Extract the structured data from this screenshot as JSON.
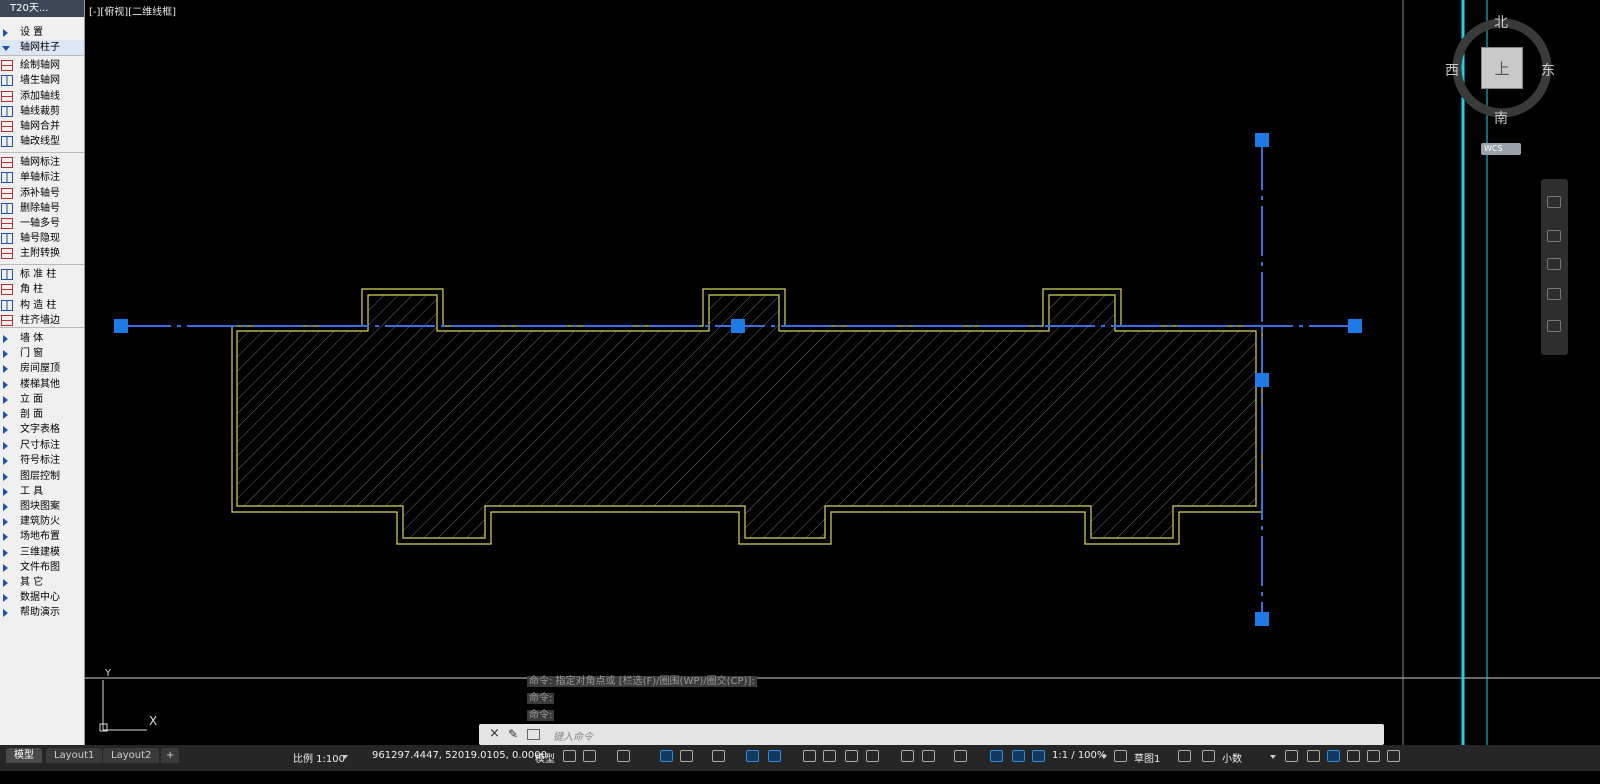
{
  "palette": {
    "title": "T20天...",
    "items": [
      {
        "label": "设 置",
        "kind": "menu"
      },
      {
        "label": "轴网柱子",
        "kind": "expanded"
      },
      {
        "label": "绘制轴网",
        "kind": "tool"
      },
      {
        "label": "墙生轴网",
        "kind": "tool"
      },
      {
        "label": "添加轴线",
        "kind": "tool"
      },
      {
        "label": "轴线裁剪",
        "kind": "tool"
      },
      {
        "label": "轴网合并",
        "kind": "tool"
      },
      {
        "label": "轴改线型",
        "kind": "tool"
      },
      {
        "label": "轴网标注",
        "kind": "tool"
      },
      {
        "label": "单轴标注",
        "kind": "tool"
      },
      {
        "label": "添补轴号",
        "kind": "tool"
      },
      {
        "label": "删除轴号",
        "kind": "tool"
      },
      {
        "label": "一轴多号",
        "kind": "tool"
      },
      {
        "label": "轴号隐现",
        "kind": "tool"
      },
      {
        "label": "主附转换",
        "kind": "tool"
      },
      {
        "label": "标 准 柱",
        "kind": "tool"
      },
      {
        "label": "角 柱",
        "kind": "tool"
      },
      {
        "label": "构 造 柱",
        "kind": "tool"
      },
      {
        "label": "柱齐墙边",
        "kind": "tool"
      },
      {
        "label": "墙 体",
        "kind": "menu"
      },
      {
        "label": "门 窗",
        "kind": "menu"
      },
      {
        "label": "房间屋顶",
        "kind": "menu"
      },
      {
        "label": "楼梯其他",
        "kind": "menu"
      },
      {
        "label": "立 面",
        "kind": "menu"
      },
      {
        "label": "剖 面",
        "kind": "menu"
      },
      {
        "label": "文字表格",
        "kind": "menu"
      },
      {
        "label": "尺寸标注",
        "kind": "menu"
      },
      {
        "label": "符号标注",
        "kind": "menu"
      },
      {
        "label": "图层控制",
        "kind": "menu"
      },
      {
        "label": "工 具",
        "kind": "menu"
      },
      {
        "label": "图块图案",
        "kind": "menu"
      },
      {
        "label": "建筑防火",
        "kind": "menu"
      },
      {
        "label": "场地布置",
        "kind": "menu"
      },
      {
        "label": "三维建模",
        "kind": "menu"
      },
      {
        "label": "文件布图",
        "kind": "menu"
      },
      {
        "label": "其 它",
        "kind": "menu"
      },
      {
        "label": "数据中心",
        "kind": "menu"
      },
      {
        "label": "帮助演示",
        "kind": "menu"
      }
    ]
  },
  "viewport": {
    "label": "[-][俯视][二维线框]"
  },
  "viewcube": {
    "north": "北",
    "south": "南",
    "east": "东",
    "west": "西",
    "face": "上",
    "wcs": "WCS"
  },
  "command": {
    "history": [
      "命令: 指定对角点或 [栏选(F)/圈围(WP)/圈交(CP)]:",
      "命令:",
      "命令:"
    ],
    "placeholder": "键入命令"
  },
  "ucs": {
    "x": "X",
    "y": "Y"
  },
  "tabs": [
    "模型",
    "Layout1",
    "Layout2",
    "+"
  ],
  "status": {
    "scale": "比例 1:100",
    "coords": "961297.4447, 52019.0105, 0.0000",
    "space": "模型",
    "annot_scale": "1:1 / 100%",
    "workspace": "草图1",
    "units": "小数"
  },
  "colors": {
    "background": "#000000",
    "outline": "#d6d65a",
    "grip": "#1e7be6",
    "axis": "#3a6fe0",
    "cyan_line": "#19d6e6"
  }
}
